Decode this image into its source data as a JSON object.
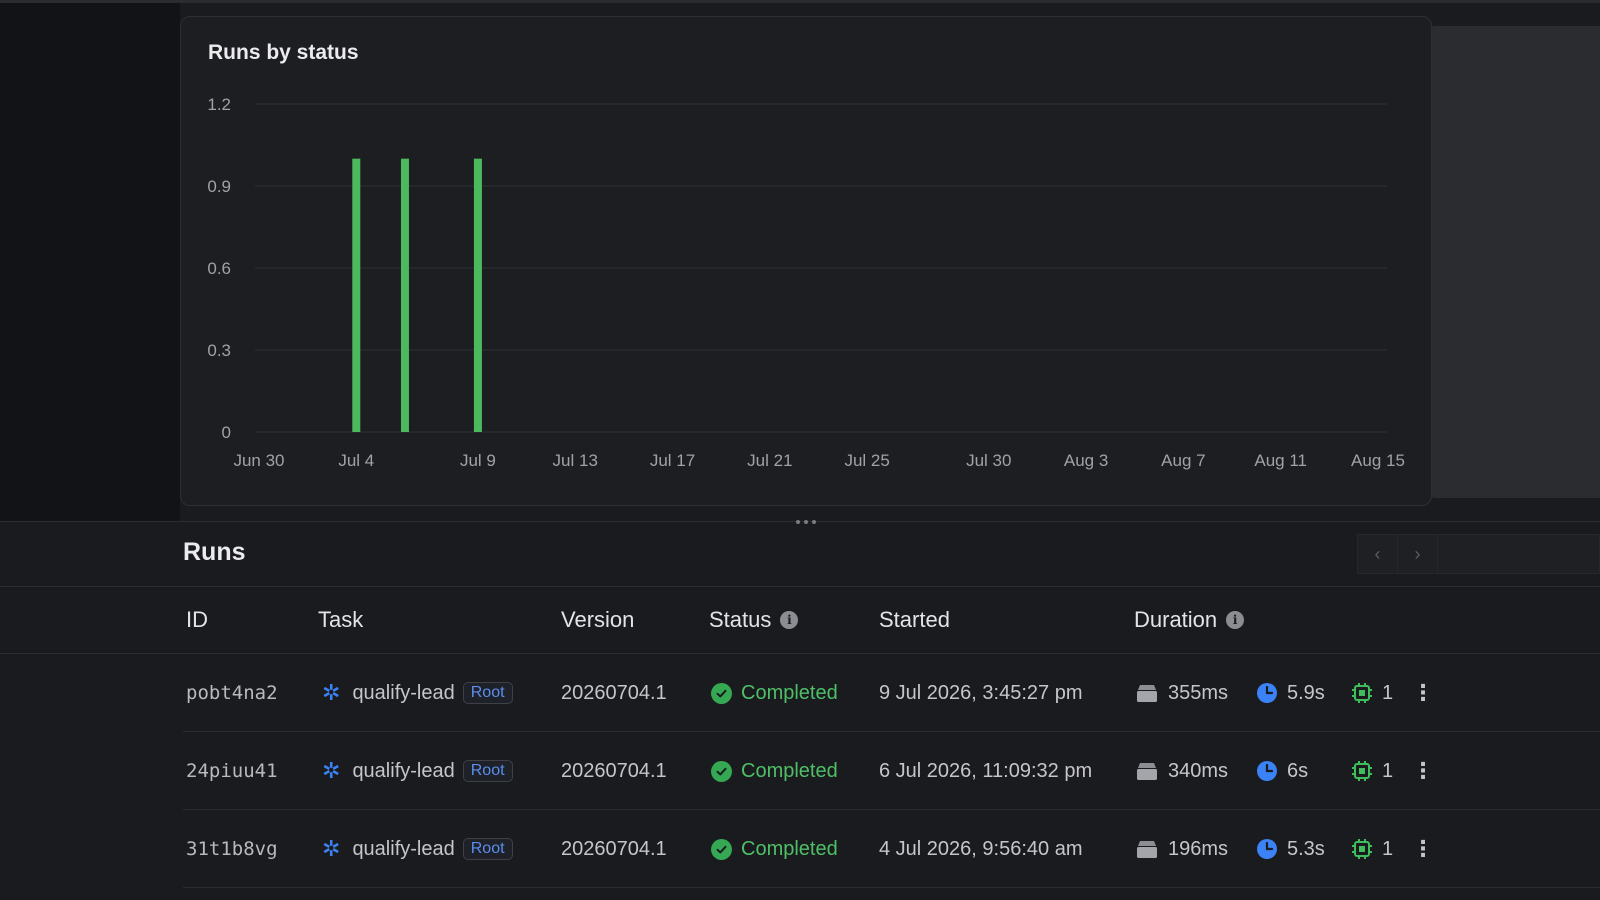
{
  "chart": {
    "title": "Runs by status",
    "color": "#4cba5c",
    "grid_color": "#2f3034"
  },
  "chart_data": {
    "type": "bar",
    "title": "Runs by status",
    "xlabel": "",
    "ylabel": "",
    "ylim": [
      0,
      1.2
    ],
    "yticks": [
      "0",
      "0.3",
      "0.6",
      "0.9",
      "1.2"
    ],
    "xticks": [
      "Jun 30",
      "Jul 4",
      "Jul 9",
      "Jul 13",
      "Jul 17",
      "Jul 21",
      "Jul 25",
      "Jul 30",
      "Aug 3",
      "Aug 7",
      "Aug 11",
      "Aug 15"
    ],
    "x_start": "Jun 30",
    "x_end": "Aug 15",
    "series": [
      {
        "name": "Completed",
        "color": "#4cba5c",
        "points": [
          {
            "x": "Jul 4",
            "y": 1
          },
          {
            "x": "Jul 6",
            "y": 1
          },
          {
            "x": "Jul 9",
            "y": 1
          }
        ]
      }
    ],
    "grid": true,
    "legend": "none"
  },
  "runs": {
    "title": "Runs",
    "pager": {
      "prev_icon": "chevron-left-icon",
      "next_icon": "chevron-right-icon"
    },
    "columns": {
      "id": "ID",
      "task": "Task",
      "version": "Version",
      "status": "Status",
      "started": "Started",
      "duration": "Duration"
    },
    "rows": [
      {
        "id": "pobt4na2",
        "task": "qualify-lead",
        "badge": "Root",
        "version": "20260704.1",
        "status": "Completed",
        "started": "9 Jul 2026, 3:45:27 pm",
        "queue": "355ms",
        "duration": "5.9s",
        "machines": "1"
      },
      {
        "id": "24piuu41",
        "task": "qualify-lead",
        "badge": "Root",
        "version": "20260704.1",
        "status": "Completed",
        "started": "6 Jul 2026, 11:09:32 pm",
        "queue": "340ms",
        "duration": "6s",
        "machines": "1"
      },
      {
        "id": "31t1b8vg",
        "task": "qualify-lead",
        "badge": "Root",
        "version": "20260704.1",
        "status": "Completed",
        "started": "4 Jul 2026, 9:56:40 am",
        "queue": "196ms",
        "duration": "5.3s",
        "machines": "1"
      }
    ]
  }
}
